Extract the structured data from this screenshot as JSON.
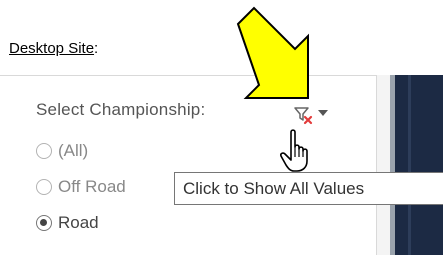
{
  "heading": {
    "label": "Desktop Site",
    "suffix": ":"
  },
  "filter_panel": {
    "title": "Select Championship:",
    "options": [
      {
        "label": "(All)",
        "selected": false
      },
      {
        "label": "Off Road",
        "selected": false
      },
      {
        "label": "Road",
        "selected": true
      }
    ],
    "clear_filter_icon": "funnel-x-icon",
    "dropdown_icon": "caret-down-icon"
  },
  "tooltip": {
    "text": "Click to Show All Values"
  },
  "annotations": {
    "arrow_icon": "yellow-arrow-icon",
    "cursor_icon": "hand-pointer-icon"
  },
  "colors": {
    "arrow_fill": "#ffff00",
    "arrow_stroke": "#000000",
    "clear_x": "#e33b3b",
    "right_pane": "#1c2a44"
  }
}
